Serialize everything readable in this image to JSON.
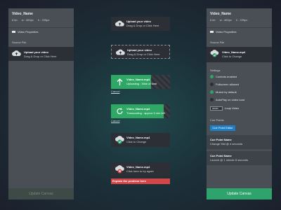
{
  "left_panel": {
    "title": "Video_Name",
    "dims": {
      "size": "6 kb",
      "width": "w : 400px",
      "height": "h : 225px"
    },
    "section": "Video Properties",
    "source_label": "Source File",
    "drop_title": "Upload your video",
    "drop_sub": "Drag & Drop or Click Here",
    "update": "Update Canvas"
  },
  "cards": {
    "upload1_title": "Upload your video",
    "upload1_sub": "Drag & Drop or Click Here",
    "upload2_title": "Upload your video",
    "upload2_sub": "Drag & Drop or Click Here",
    "uploading_title": "Video_Name.mp4",
    "uploading_sub": "Uploading : 30kb of 6mb",
    "cancel1": "Cancel",
    "transcoding_title": "Video_Name.mp4",
    "transcoding_sub": "Transcoding : approx 5 min left",
    "cancel2": "Cancel",
    "done_title": "Video_Name.mp4",
    "done_sub": "Click to Change",
    "error_title": "Video_Name.mp4",
    "error_sub": "Click here to try again",
    "error_msg": "Explain the problem here"
  },
  "right_panel": {
    "title": "Video_Name",
    "dims": {
      "size": "6 kb",
      "width": "w : 400px",
      "height": "h : 225px"
    },
    "section": "Video Properties",
    "source_label": "Source File",
    "file_title": "Video_Name.mp4",
    "file_sub": "Click to Change",
    "settings_label": "Settings",
    "settings": [
      {
        "label": "Controls enabled",
        "on": true
      },
      {
        "label": "Fullscreen allowed",
        "on": false
      },
      {
        "label": "Muted by default",
        "on": true
      },
      {
        "label": "AutoPlay on video load",
        "on": false
      }
    ],
    "loop_value": "never",
    "loop_label": "Loop Video",
    "cue_label": "Cue Points",
    "cue_button": "Cue Point Editor",
    "cues": [
      {
        "name": "Cue Point Name",
        "detail": "Change Slid  @  4 seconds"
      },
      {
        "name": "Cue Point Name",
        "detail": "Launch  @ 1 minute 8 seconds"
      }
    ],
    "update": "Update Canvas"
  },
  "colors": {
    "accent": "#2ea36b",
    "error": "#d64545",
    "cue_button": "#1f7fc4",
    "panel": "#4a4f55"
  }
}
